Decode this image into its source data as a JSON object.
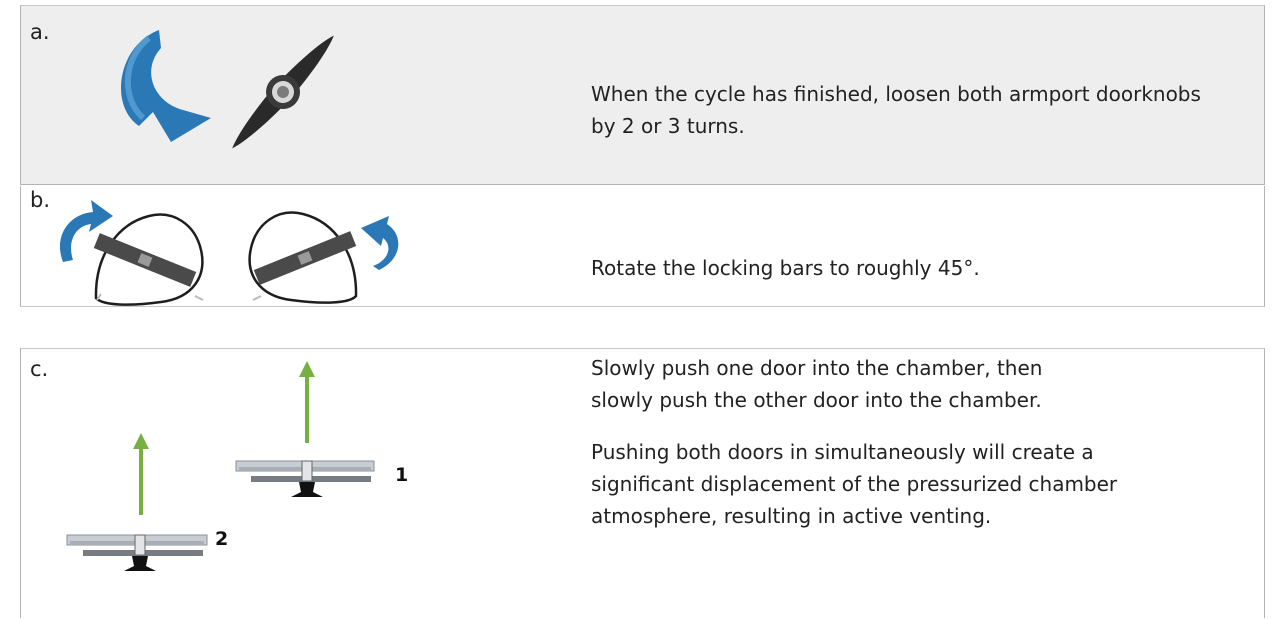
{
  "steps": [
    {
      "label": "a.",
      "text": "When the cycle has finished, loosen both armport doorknobs by 2 or 3 turns."
    },
    {
      "label": "b.",
      "text": "Rotate the locking bars to roughly 45°."
    },
    {
      "label": "c.",
      "paragraphs": [
        "Slowly push one door into the chamber, then slowly push the other door into the chamber.",
        "Pushing both doors in simultaneously will create a significant displacement of the pressurized chamber atmosphere, resulting in active venting."
      ],
      "door_numbers": [
        "1",
        "2"
      ]
    }
  ],
  "colors": {
    "arrow_blue": "#2b78b6",
    "arrow_green": "#76b043",
    "panel_gray": "#eeeeee"
  }
}
